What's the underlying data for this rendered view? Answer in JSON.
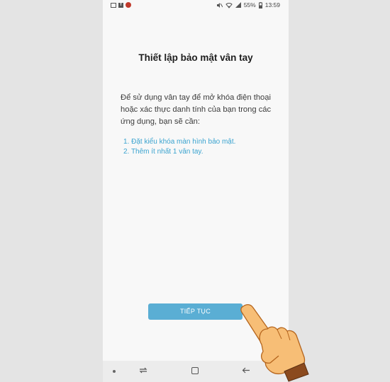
{
  "statusbar": {
    "left_icons": [
      "gallery-icon",
      "facebook-icon",
      "app-icon"
    ],
    "battery_percent": "55%",
    "time": "13:59"
  },
  "screen": {
    "title": "Thiết lập bảo mật vân tay",
    "description": "Để sử dụng vân tay để mở khóa điện thoại hoặc xác thực danh tính của bạn trong các ứng dụng, bạn sẽ cần:",
    "steps": [
      "1. Đặt kiểu khóa màn hình bảo mật.",
      "2. Thêm ít nhất 1 vân tay."
    ],
    "continue_button": "TIẾP TỤC"
  },
  "colors": {
    "accent": "#5aaed4",
    "link": "#3aa3cf",
    "background": "#e4e4e4"
  },
  "navbar": {
    "icons": [
      "dot-icon",
      "recent-apps-icon",
      "home-icon",
      "back-icon"
    ]
  }
}
